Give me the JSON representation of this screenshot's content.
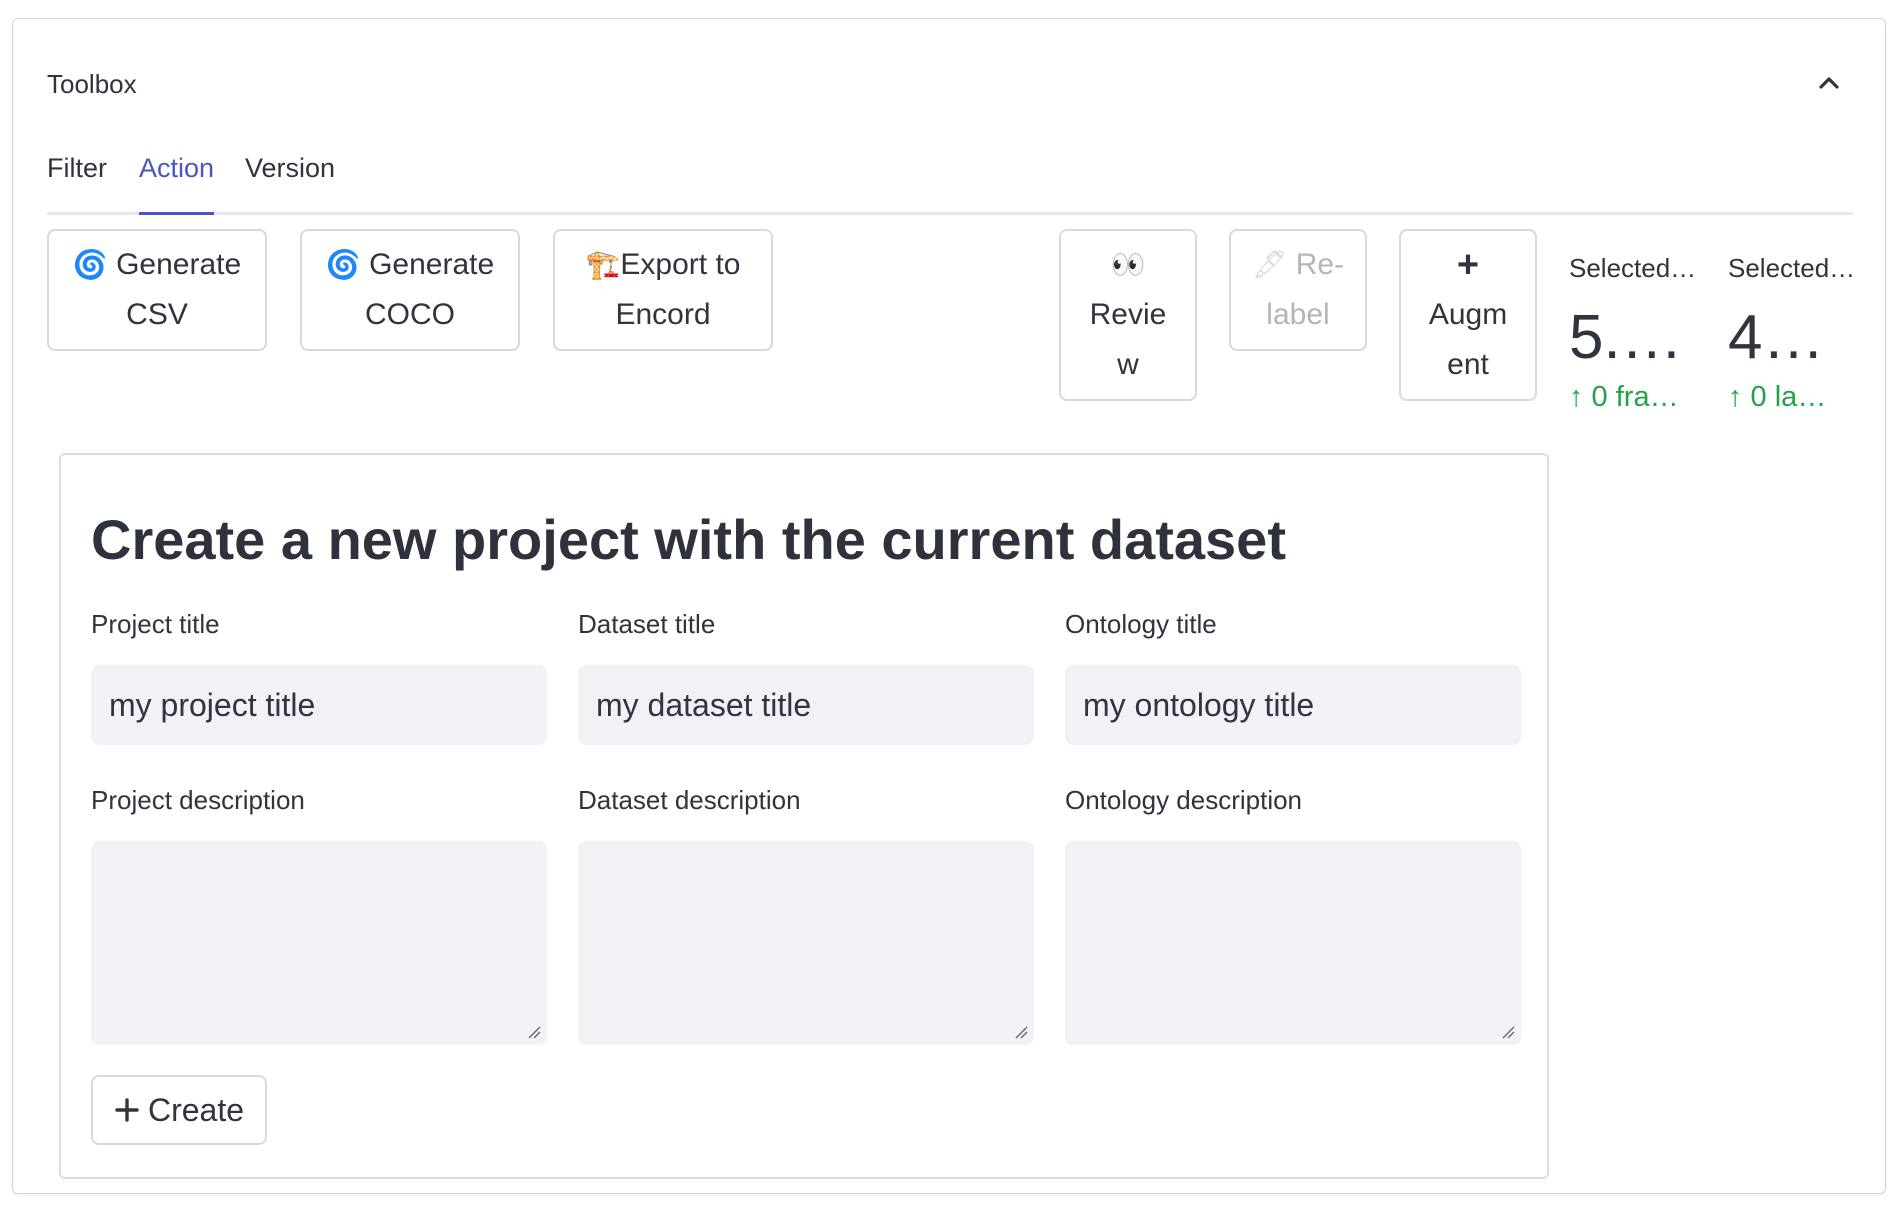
{
  "expander": {
    "title": "Toolbox"
  },
  "tabs": [
    {
      "label": "Filter",
      "active": false
    },
    {
      "label": "Action",
      "active": true
    },
    {
      "label": "Version",
      "active": false
    }
  ],
  "actions": {
    "generate_csv": {
      "icon": "🌀",
      "line1": "Generate",
      "line2": "CSV"
    },
    "generate_coco": {
      "icon": "🌀",
      "line1": "Generate",
      "line2": "COCO"
    },
    "export_encord": {
      "icon": "🏗️",
      "line1": "Export to",
      "line2": "Encord"
    },
    "review": {
      "icon": "👀",
      "line1": "Revie",
      "line2": "w"
    },
    "relabel": {
      "icon": "🖋",
      "line1": "Re-",
      "line2": "label",
      "disabled": true
    },
    "augment": {
      "icon": "+",
      "line1": "Augm",
      "line2": "ent"
    }
  },
  "metrics": [
    {
      "label": "Selected…",
      "value": "5.…",
      "delta": "↑ 0 fra…"
    },
    {
      "label": "Selected…",
      "value": "4…",
      "delta": "↑ 0 la…"
    }
  ],
  "form": {
    "title": "Create a new project with the current dataset",
    "project_title_label": "Project title",
    "project_title_value": "my project title",
    "dataset_title_label": "Dataset title",
    "dataset_title_value": "my dataset title",
    "ontology_title_label": "Ontology title",
    "ontology_title_value": "my ontology title",
    "project_description_label": "Project description",
    "dataset_description_label": "Dataset description",
    "ontology_description_label": "Ontology description",
    "create_label": "Create"
  },
  "colors": {
    "accent": "#4a54c8",
    "positive": "#21a347",
    "input_bg": "#f0f2f6"
  }
}
